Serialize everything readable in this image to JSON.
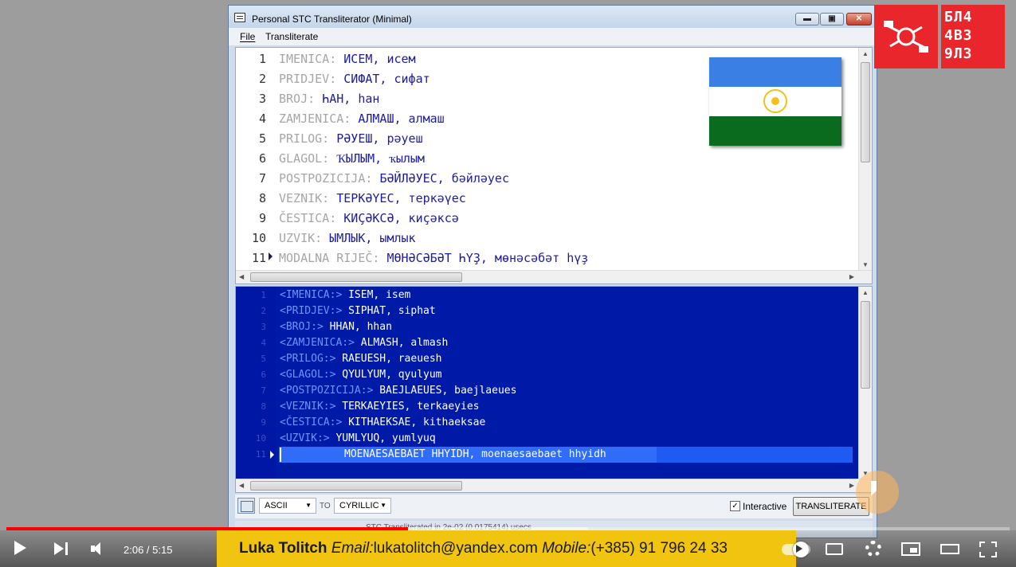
{
  "window": {
    "title": "Personal STC Transliterator (Minimal)",
    "min_glyph": "▬",
    "max_glyph": "▣",
    "close_glyph": "✕"
  },
  "menu": {
    "file": "File",
    "transliterate": "Transliterate"
  },
  "source_lines": [
    {
      "num": "1",
      "label": "IMENICA:",
      "text": "ИСЕМ, исем"
    },
    {
      "num": "2",
      "label": "PRIDJEV:",
      "text": "СИФАТ, сифат"
    },
    {
      "num": "3",
      "label": "BROJ:",
      "text": "ҺАН, һан"
    },
    {
      "num": "4",
      "label": "ZAMJENICA:",
      "text": "АЛМАШ, алмаш"
    },
    {
      "num": "5",
      "label": "PRILOG:",
      "text": "РӘУЕШ, рәуеш"
    },
    {
      "num": "6",
      "label": "GLAGOL:",
      "text": "ҠЫЛЫМ, ҡылым"
    },
    {
      "num": "7",
      "label": "POSTPOZICIJA:",
      "text": "БӘЙЛӘУЕС, бәйләуес"
    },
    {
      "num": "8",
      "label": "VEZNIK:",
      "text": "ТЕРКӘҮЕС, теркәүес"
    },
    {
      "num": "9",
      "label": "ČESTICA:",
      "text": "КИҪӘКСӘ, киҫәксә"
    },
    {
      "num": "10",
      "label": "UZVIK:",
      "text": "ЫМЛЫК, ымлык"
    },
    {
      "num": "11",
      "label": "MODALNA RIJEČ:",
      "text": "МӨНӘСӘБӘТ ҺҮҘ, мөнәсәбәт һүҙ"
    }
  ],
  "output_lines": [
    {
      "num": "1",
      "label": "<IMENICA:>",
      "text": "ISEM, isem"
    },
    {
      "num": "2",
      "label": "<PRIDJEV:>",
      "text": "SIPHAT, siphat"
    },
    {
      "num": "3",
      "label": "<BROJ:>",
      "text": "HHAN, hhan"
    },
    {
      "num": "4",
      "label": "<ZAMJENICA:>",
      "text": "ALMASH, almash"
    },
    {
      "num": "5",
      "label": "<PRILOG:>",
      "text": "RAEUESH, raeuesh"
    },
    {
      "num": "6",
      "label": "<GLAGOL:>",
      "text": "QYULYUM, qyulyum"
    },
    {
      "num": "7",
      "label": "<POSTPOZICIJA:>",
      "text": "BAEJLAEUES, baejlaeues"
    },
    {
      "num": "8",
      "label": "<VEZNIK:>",
      "text": "TERKAEYIES, terkaeyies"
    },
    {
      "num": "9",
      "label": "<ČESTICA:>",
      "text": "KITHAEKSAE, kithaeksae"
    },
    {
      "num": "10",
      "label": "<UZVIK:>",
      "text": "YUMLYUQ, yumlyuq"
    },
    {
      "num": "11",
      "label": "",
      "text": "MOENAESAEBAET HHYIDH, moenaesaebaet hhyidh"
    }
  ],
  "flag_colors": {
    "top": "#3a7fe4",
    "middle": "#ffffff",
    "bottom": "#0a6a1e",
    "emblem": "#f2c21a"
  },
  "bottom": {
    "from_value": "ASCII",
    "to_label": "TO",
    "to_value": "CYRILLIC",
    "interactive_label": "Interactive",
    "interactive_checked": "✓",
    "transliterate_button": "TRANSLITERATE",
    "status": "STC Transliterated in 2e-02 (0.0175414) usecs"
  },
  "logo": {
    "text": "БЛ4\n4В3\n9Л3",
    "color": "#e9262b"
  },
  "player": {
    "time": "2:06 / 5:15",
    "progress": 0.4,
    "buffered": 0.58,
    "ad": {
      "name": "Luka Tolitch",
      "email_label": "Email:",
      "email": "lukatolitch@yandex.com",
      "mobile_label": "Mobile:",
      "mobile": "(+385) 91 796 24 33"
    }
  },
  "icons": {
    "play": "play-icon",
    "next": "next-icon",
    "volume": "volume-icon",
    "autoplay": "autoplay-toggle-icon",
    "cc": "subtitles-icon",
    "settings": "gear-icon",
    "miniplayer": "miniplayer-icon",
    "theater": "theater-icon",
    "fullscreen": "fullscreen-icon"
  }
}
